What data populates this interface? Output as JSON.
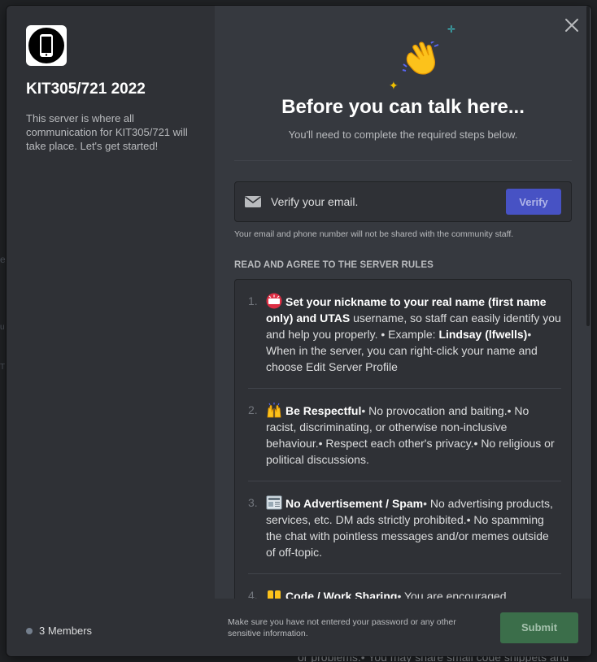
{
  "server": {
    "name": "KIT305/721 2022",
    "description": "This server is where all communication for KIT305/721 will take place. Let's get started!",
    "members": "3 Members"
  },
  "gate": {
    "title": "Before you can talk here...",
    "subtitle": "You'll need to complete the required steps below."
  },
  "verify": {
    "text": "Verify your email.",
    "button_label": "Verify",
    "privacy_note": "Your email and phone number will not be shared with the community staff."
  },
  "rules": {
    "header": "READ AND AGREE TO THE SERVER RULES",
    "items": [
      {
        "number": "1.",
        "icon": "name-badge-icon",
        "bold1": "Set your nickname to your real name (first name only) and UTAS",
        "text1": " username, so staff can easily identify you and help you properly. • Example: ",
        "bold2": "Lindsay (lfwells)",
        "text2": "• When in the server, you can right-click your name and choose Edit Server Profile"
      },
      {
        "number": "2.",
        "icon": "raised-hands-icon",
        "bold1": "Be Respectful",
        "text1": "• No provocation and baiting.• No racist, discriminating, or otherwise non-inclusive behaviour.• Respect each other's privacy.• No religious or political discussions."
      },
      {
        "number": "3.",
        "icon": "newspaper-icon",
        "bold1": "No Advertisement / Spam",
        "text1": "• No advertising products, services, etc. DM ads strictly prohibited.• No spamming the chat with pointless messages and/or memes outside of off-topic."
      },
      {
        "number": "4.",
        "icon": "handshake-icon",
        "bold1": "Code / Work Sharing",
        "text1": "• You are encouraged"
      }
    ]
  },
  "footer": {
    "note": "Make sure you have not entered your password or any other sensitive information.",
    "submit_label": "Submit"
  },
  "background_fragments": [
    "e",
    "u",
    "T",
    "or problems.• You may share small code snippets and"
  ],
  "colors": {
    "verify_button": "#4752c4",
    "submit_button": "#3b6e4a",
    "modal_side": "#2f3136",
    "modal_main": "#36393f"
  }
}
